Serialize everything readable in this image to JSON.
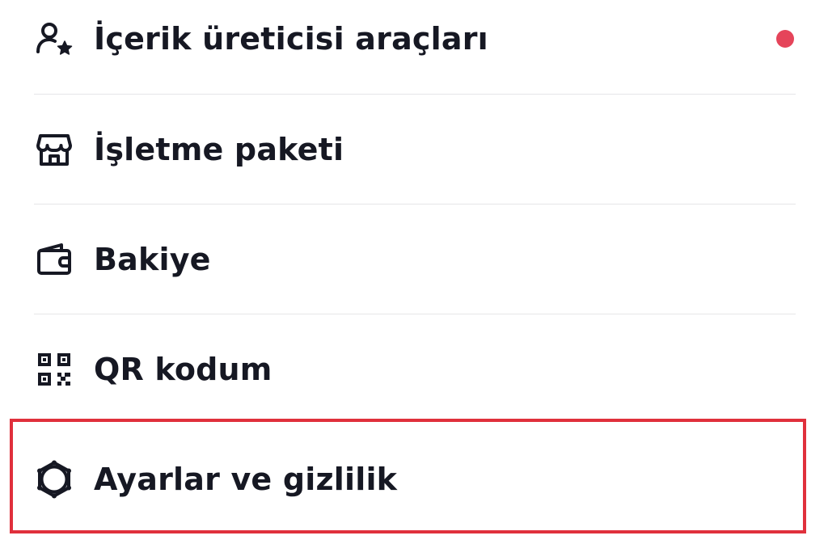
{
  "menu": {
    "items": [
      {
        "label": "İçerik üreticisi araçları",
        "icon": "creator-tools-icon",
        "notification": true
      },
      {
        "label": "İşletme paketi",
        "icon": "storefront-icon",
        "notification": false
      },
      {
        "label": "Bakiye",
        "icon": "wallet-icon",
        "notification": false
      },
      {
        "label": "QR kodum",
        "icon": "qr-code-icon",
        "notification": false
      },
      {
        "label": "Ayarlar ve gizlilik",
        "icon": "settings-gear-icon",
        "notification": false,
        "highlighted": true
      }
    ]
  },
  "colors": {
    "text": "#161823",
    "notification_dot": "#e5445a",
    "highlight_border": "#e0303c",
    "divider": "#e6e6e8"
  }
}
